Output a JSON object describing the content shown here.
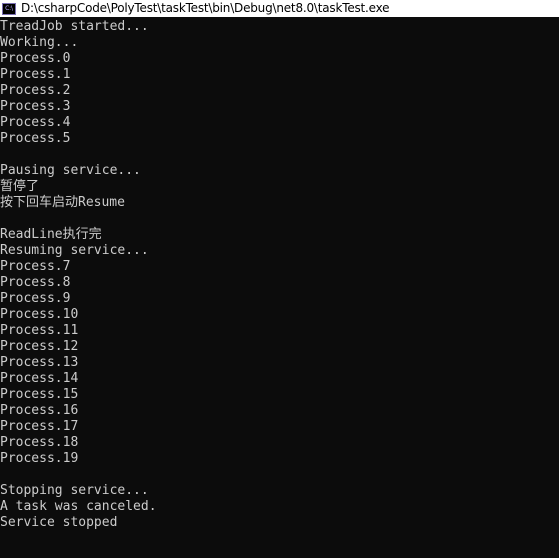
{
  "window": {
    "title": "D:\\csharpCode\\PolyTest\\taskTest\\bin\\Debug\\net8.0\\taskTest.exe",
    "icon": "console-app-icon",
    "icon_text": "C:\\",
    "bg_color": "#0c0c0c",
    "text_color": "#cccccc"
  },
  "console": {
    "lines": [
      "TreadJob started...",
      "Working...",
      "Process.0",
      "Process.1",
      "Process.2",
      "Process.3",
      "Process.4",
      "Process.5",
      "",
      "Pausing service...",
      "暂停了",
      "按下回车启动Resume",
      "",
      "ReadLine执行完",
      "Resuming service...",
      "Process.7",
      "Process.8",
      "Process.9",
      "Process.10",
      "Process.11",
      "Process.12",
      "Process.13",
      "Process.14",
      "Process.15",
      "Process.16",
      "Process.17",
      "Process.18",
      "Process.19",
      "",
      "Stopping service...",
      "A task was canceled.",
      "Service stopped"
    ]
  }
}
